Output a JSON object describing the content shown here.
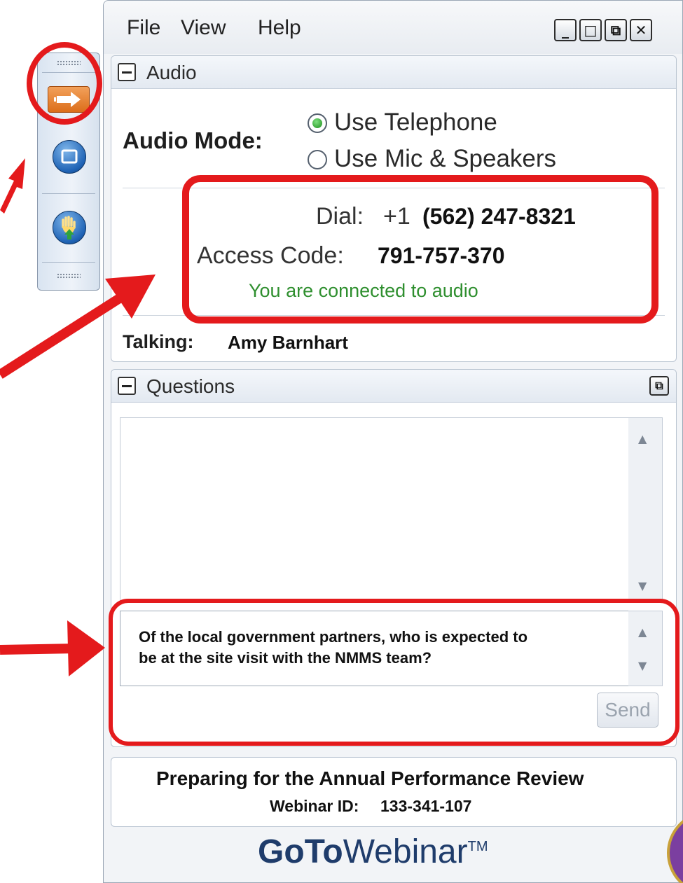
{
  "menu": {
    "file": "File",
    "view": "View",
    "help": "Help"
  },
  "window_controls": {
    "minimize": "_",
    "maximize": "□",
    "restore": "⧉",
    "close": "✕"
  },
  "audio": {
    "title": "Audio",
    "mode_label": "Audio Mode:",
    "options": [
      "Use Telephone",
      "Use Mic & Speakers"
    ],
    "selected": "Use Telephone",
    "dial_label": "Dial:",
    "dial_prefix": "+1",
    "dial_number": "(562) 247-8321",
    "access_label": "Access Code:",
    "access_code": "791-757-370",
    "status": "You are connected to audio",
    "talking_label": "Talking:",
    "talking_name": "Amy Barnhart"
  },
  "questions": {
    "title": "Questions",
    "draft_line1": "Of the local government partners, who is expected to",
    "draft_line2": "be at the site visit with the NMMS team?",
    "send_label": "Send"
  },
  "webinar": {
    "title": "Preparing for the Annual Performance Review",
    "id_label": "Webinar ID:",
    "id_value": "133-341-107"
  },
  "brand": {
    "goto": "GoTo",
    "webinar": "Webinar",
    "tm": "TM"
  },
  "colors": {
    "annotation_red": "#e41a1c",
    "status_green": "#2f8f2f",
    "brand_navy": "#1f3c6b",
    "toolbar_orange": "#e07828"
  },
  "icons": [
    "grip-icon",
    "show-panel-arrow-icon",
    "screen-icon",
    "raise-hand-icon",
    "collapse-icon",
    "radio-icon",
    "popout-icon",
    "scroll-up-icon",
    "scroll-down-icon"
  ]
}
